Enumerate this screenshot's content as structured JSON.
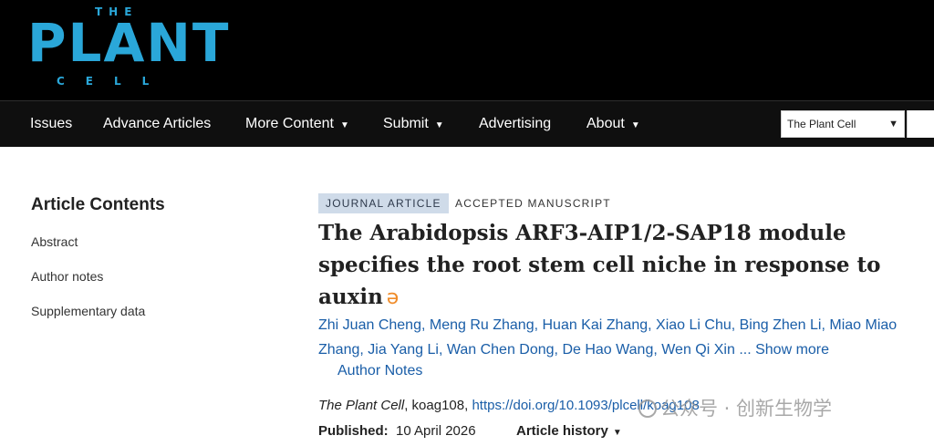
{
  "header": {
    "logo": {
      "the": "THE",
      "plant": "PLANT",
      "cell": "CELL"
    },
    "nav": [
      {
        "label": "Issues",
        "dropdown": false
      },
      {
        "label": "Advance Articles",
        "dropdown": false
      },
      {
        "label": "More Content",
        "dropdown": true
      },
      {
        "label": "Submit",
        "dropdown": true
      },
      {
        "label": "Advertising",
        "dropdown": false
      },
      {
        "label": "About",
        "dropdown": true
      }
    ],
    "journal_select": "The Plant Cell"
  },
  "sidebar": {
    "title": "Article Contents",
    "items": [
      "Abstract",
      "Author notes",
      "Supplementary data"
    ]
  },
  "article": {
    "badge": "JOURNAL ARTICLE",
    "status": "ACCEPTED MANUSCRIPT",
    "title": "The Arabidopsis ARF3-AIP1/2-SAP18 module specifies the root stem cell niche in response to auxin",
    "open_access_icon": "open-access-icon",
    "authors": [
      "Zhi Juan Cheng",
      "Meng Ru Zhang",
      "Huan Kai Zhang",
      "Xiao Li Chu",
      "Bing Zhen Li",
      "Miao Miao Zhang",
      "Jia Yang Li",
      "Wan Chen Dong",
      "De Hao Wang",
      "Wen Qi Xin"
    ],
    "ellipsis": "...",
    "show_more": "Show more",
    "author_notes": "Author Notes",
    "citation": {
      "journal": "The Plant Cell",
      "article_id": ", koag108, ",
      "doi": "https://doi.org/10.1093/plcell/koag108"
    },
    "published_label": "Published:",
    "published_date": "10 April 2026",
    "history": "Article history"
  },
  "watermark": "公众号 · 创新生物学",
  "colors": {
    "logo": "#2aa7d9",
    "link": "#1a5ea8",
    "badge_bg": "#cfdbe9",
    "oa": "#f08c2a"
  }
}
